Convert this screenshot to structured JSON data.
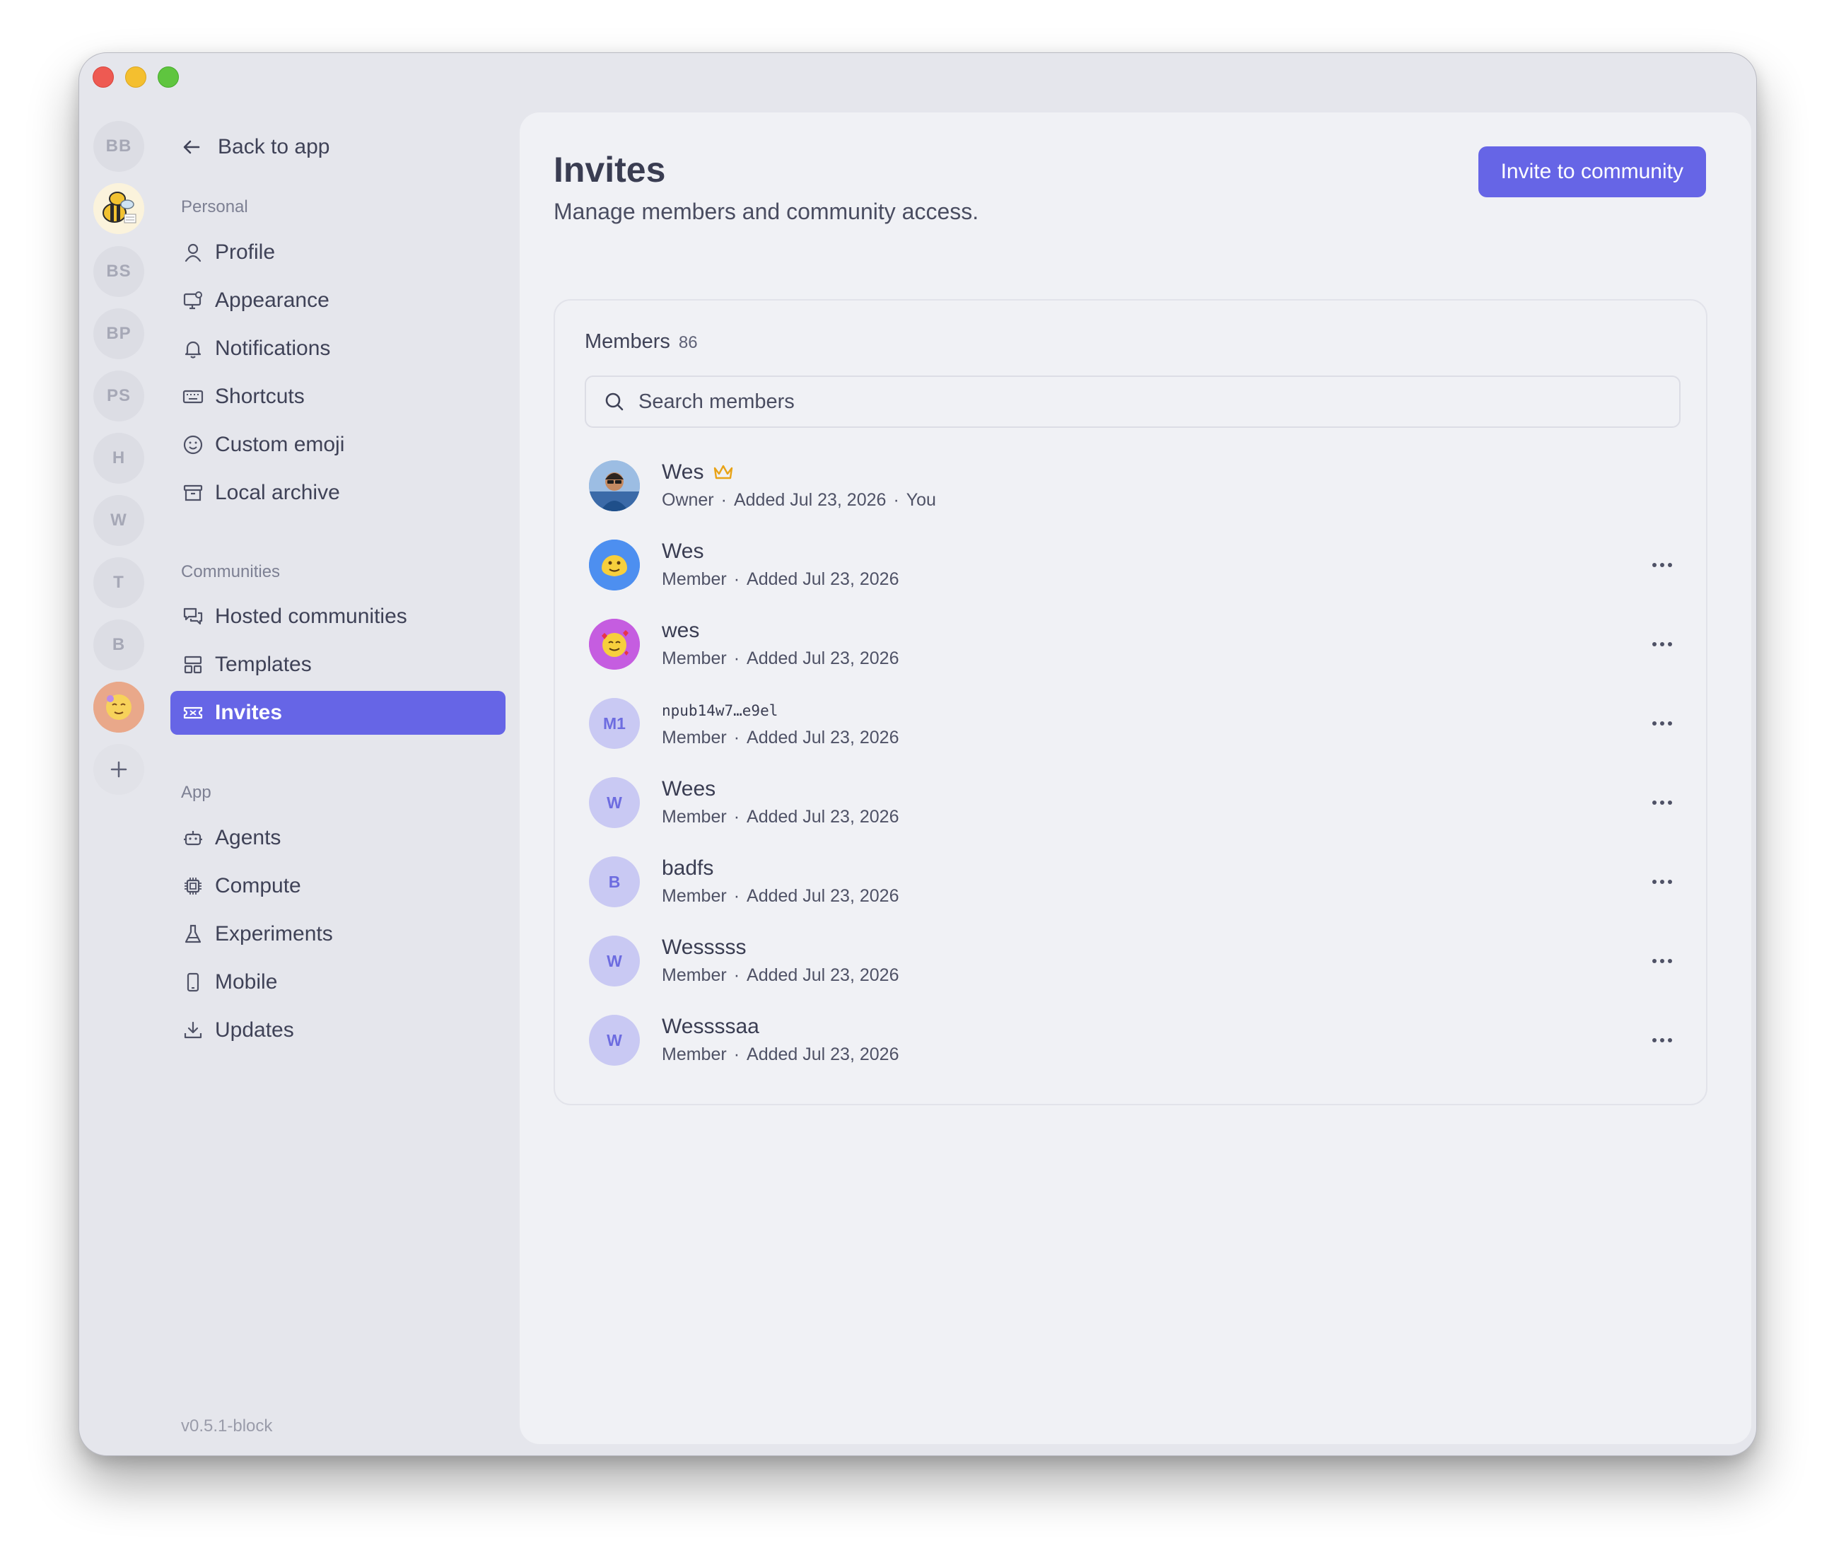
{
  "rail": {
    "items": [
      "BB",
      "BS",
      "BP",
      "PS",
      "H",
      "W",
      "T",
      "B"
    ],
    "add_icon": "plus-icon"
  },
  "sidebar": {
    "back_label": "Back to app",
    "sections": {
      "personal": "Personal",
      "communities": "Communities",
      "app": "App"
    },
    "personal_items": [
      {
        "label": "Profile",
        "icon": "user-icon"
      },
      {
        "label": "Appearance",
        "icon": "monitor-gear-icon"
      },
      {
        "label": "Notifications",
        "icon": "bell-icon"
      },
      {
        "label": "Shortcuts",
        "icon": "keyboard-icon"
      },
      {
        "label": "Custom emoji",
        "icon": "smile-icon"
      },
      {
        "label": "Local archive",
        "icon": "archive-icon"
      }
    ],
    "community_items": [
      {
        "label": "Hosted communities",
        "icon": "chat-bubbles-icon"
      },
      {
        "label": "Templates",
        "icon": "layout-icon"
      },
      {
        "label": "Invites",
        "icon": "ticket-icon",
        "active": true
      }
    ],
    "app_items": [
      {
        "label": "Agents",
        "icon": "robot-icon"
      },
      {
        "label": "Compute",
        "icon": "cpu-icon"
      },
      {
        "label": "Experiments",
        "icon": "flask-icon"
      },
      {
        "label": "Mobile",
        "icon": "phone-icon"
      },
      {
        "label": "Updates",
        "icon": "download-icon"
      }
    ],
    "version": "v0.5.1-block"
  },
  "main": {
    "title": "Invites",
    "subtitle": "Manage members and community access.",
    "invite_button": "Invite to community",
    "members_label": "Members",
    "members_count": "86",
    "search_placeholder": "Search members",
    "members": [
      {
        "name": "Wes",
        "role": "Owner",
        "added": "Added Jul 23, 2026",
        "extra": "You",
        "avatar": "photo",
        "crown": true
      },
      {
        "name": "Wes",
        "role": "Member",
        "added": "Added Jul 23, 2026",
        "avatar": "emoji-melting"
      },
      {
        "name": "wes",
        "role": "Member",
        "added": "Added Jul 23, 2026",
        "avatar": "emoji-hearts"
      },
      {
        "name": "npub14w7…e9el",
        "role": "Member",
        "added": "Added Jul 23, 2026",
        "avatar_text": "M1",
        "mono": true
      },
      {
        "name": "Wees",
        "role": "Member",
        "added": "Added Jul 23, 2026",
        "avatar_text": "W"
      },
      {
        "name": "badfs",
        "role": "Member",
        "added": "Added Jul 23, 2026",
        "avatar_text": "B"
      },
      {
        "name": "Wesssss",
        "role": "Member",
        "added": "Added Jul 23, 2026",
        "avatar_text": "W"
      },
      {
        "name": "Wessssaa",
        "role": "Member",
        "added": "Added Jul 23, 2026",
        "avatar_text": "W"
      }
    ],
    "meta_separator": "·"
  },
  "colors": {
    "accent": "#6665e6",
    "window_bg": "#e5e6ec",
    "panel_bg": "#f0f1f5",
    "crown": "#e8a317"
  }
}
